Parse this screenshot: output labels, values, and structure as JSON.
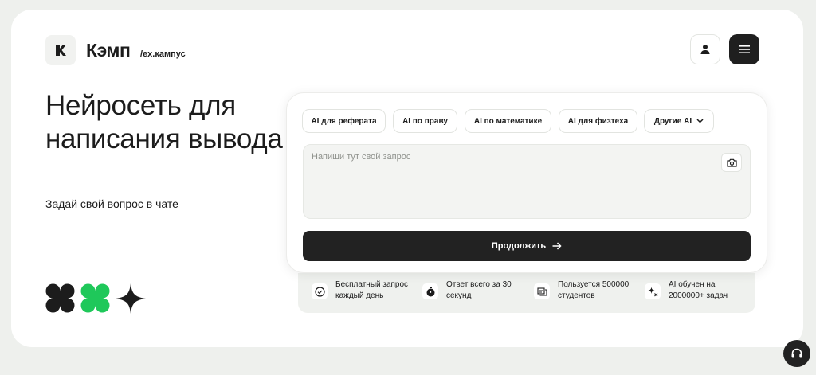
{
  "header": {
    "brand_name": "Кэмп",
    "brand_sub": "/ex.кампус",
    "logo_letter": "K",
    "profile_icon": "user-icon",
    "menu_icon": "hamburger-menu-icon"
  },
  "hero": {
    "title": "Нейросеть для написания вывода",
    "subtitle": "Задай свой вопрос в чате"
  },
  "tabs": [
    {
      "label": "AI для реферата"
    },
    {
      "label": "AI по праву"
    },
    {
      "label": "AI по математике"
    },
    {
      "label": "AI для физтеха"
    },
    {
      "label": "Другие AI"
    }
  ],
  "query": {
    "placeholder": "Напиши тут свой запрос",
    "value": ""
  },
  "submit": {
    "label": "Продолжить"
  },
  "features": [
    {
      "icon": "check-circle-icon",
      "text": "Бесплатный запрос каждый день"
    },
    {
      "icon": "stopwatch-icon",
      "text": "Ответ всего за 30 секунд"
    },
    {
      "icon": "users-screen-icon",
      "text": "Пользуется 500000 студентов"
    },
    {
      "icon": "sparkles-icon",
      "text": "AI обучен на 2000000+ задач"
    }
  ],
  "colors": {
    "background": "#eef0ed",
    "card": "#ffffff",
    "dark": "#1f1f1f",
    "accent_green": "#1fc85a"
  }
}
